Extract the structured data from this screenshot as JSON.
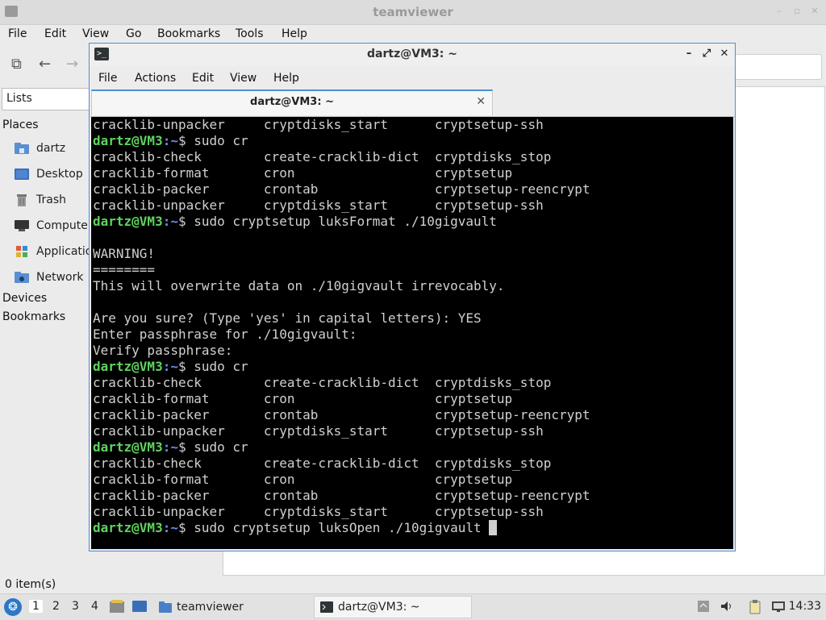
{
  "file_manager": {
    "title": "teamviewer",
    "menu": [
      "File",
      "Edit",
      "View",
      "Go",
      "Bookmarks",
      "Tools",
      "Help"
    ],
    "sidebar": {
      "view_selector": "Lists",
      "places_header": "Places",
      "places": [
        {
          "label": "dartz",
          "icon": "home-folder-icon"
        },
        {
          "label": "Desktop",
          "icon": "desktop-icon"
        },
        {
          "label": "Trash",
          "icon": "trash-icon"
        },
        {
          "label": "Computer",
          "icon": "computer-icon"
        },
        {
          "label": "Applications",
          "icon": "applications-icon"
        },
        {
          "label": "Network",
          "icon": "network-icon"
        }
      ],
      "devices_header": "Devices",
      "bookmarks_header": "Bookmarks"
    },
    "status": "0 item(s)"
  },
  "terminal": {
    "title": "dartz@VM3: ~",
    "menu": [
      "File",
      "Actions",
      "Edit",
      "View",
      "Help"
    ],
    "tab_label": "dartz@VM3: ~",
    "prompt_user": "dartz@VM3",
    "prompt_path": ":~",
    "prompt_symbol": "$ ",
    "lines": [
      {
        "type": "out",
        "text": "cracklib-unpacker     cryptdisks_start      cryptsetup-ssh"
      },
      {
        "type": "cmd",
        "text": "sudo cr"
      },
      {
        "type": "out",
        "text": "cracklib-check        create-cracklib-dict  cryptdisks_stop"
      },
      {
        "type": "out",
        "text": "cracklib-format       cron                  cryptsetup"
      },
      {
        "type": "out",
        "text": "cracklib-packer       crontab               cryptsetup-reencrypt"
      },
      {
        "type": "out",
        "text": "cracklib-unpacker     cryptdisks_start      cryptsetup-ssh"
      },
      {
        "type": "cmd",
        "text": "sudo cryptsetup luksFormat ./10gigvault"
      },
      {
        "type": "out",
        "text": ""
      },
      {
        "type": "out",
        "text": "WARNING!"
      },
      {
        "type": "out",
        "text": "========"
      },
      {
        "type": "out",
        "text": "This will overwrite data on ./10gigvault irrevocably."
      },
      {
        "type": "out",
        "text": ""
      },
      {
        "type": "out",
        "text": "Are you sure? (Type 'yes' in capital letters): YES"
      },
      {
        "type": "out",
        "text": "Enter passphrase for ./10gigvault:"
      },
      {
        "type": "out",
        "text": "Verify passphrase:"
      },
      {
        "type": "cmd",
        "text": "sudo cr"
      },
      {
        "type": "out",
        "text": "cracklib-check        create-cracklib-dict  cryptdisks_stop"
      },
      {
        "type": "out",
        "text": "cracklib-format       cron                  cryptsetup"
      },
      {
        "type": "out",
        "text": "cracklib-packer       crontab               cryptsetup-reencrypt"
      },
      {
        "type": "out",
        "text": "cracklib-unpacker     cryptdisks_start      cryptsetup-ssh"
      },
      {
        "type": "cmd",
        "text": "sudo cr"
      },
      {
        "type": "out",
        "text": "cracklib-check        create-cracklib-dict  cryptdisks_stop"
      },
      {
        "type": "out",
        "text": "cracklib-format       cron                  cryptsetup"
      },
      {
        "type": "out",
        "text": "cracklib-packer       crontab               cryptsetup-reencrypt"
      },
      {
        "type": "out",
        "text": "cracklib-unpacker     cryptdisks_start      cryptsetup-ssh"
      },
      {
        "type": "cmd",
        "text": "sudo cryptsetup luksOpen ./10gigvault ",
        "cursor": true
      }
    ]
  },
  "taskbar": {
    "workspaces": [
      "1",
      "2",
      "3",
      "4"
    ],
    "tasks": [
      {
        "label": "teamviewer",
        "icon": "folder-icon"
      },
      {
        "label": "dartz@VM3: ~",
        "icon": "terminal-icon"
      }
    ],
    "clock": "14:33"
  },
  "colors": {
    "prompt_user": "#5fd35f",
    "prompt_path": "#6a8ee8",
    "accent": "#4a8fd6"
  }
}
